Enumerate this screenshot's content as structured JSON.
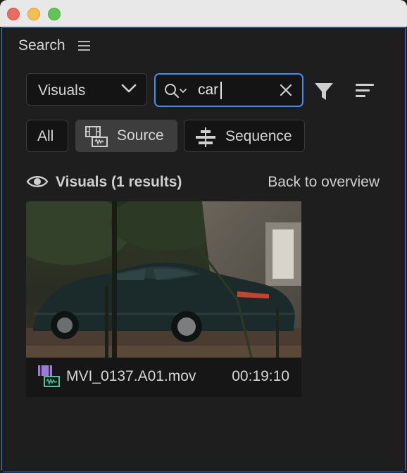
{
  "window": {
    "controls": [
      "close",
      "minimize",
      "zoom"
    ]
  },
  "panel": {
    "title": "Search",
    "menu_icon": "hamburger-menu-icon"
  },
  "filters": {
    "scope_dropdown": {
      "selected": "Visuals",
      "icon": "chevron-down-icon"
    },
    "search": {
      "value": "car",
      "icon": "search-options-icon",
      "clear_icon": "clear-icon"
    },
    "filter_icon": "funnel-icon",
    "sort_icon": "sort-lines-icon"
  },
  "chips": [
    {
      "label": "All"
    },
    {
      "label": "Source",
      "icon": "source-clip-icon",
      "active": true
    },
    {
      "label": "Sequence",
      "icon": "sequence-icon"
    }
  ],
  "results": {
    "icon": "eye-icon",
    "title": "Visuals (1 results)",
    "back_link": "Back to overview",
    "items": [
      {
        "name": "MVI_0137.A01.mov",
        "duration": "00:19:10",
        "icon": "video-audio-clip-icon"
      }
    ]
  },
  "colors": {
    "accent": "#3e8ef5",
    "background": "#1e1e1e",
    "active_chip": "#3d3d3d"
  }
}
